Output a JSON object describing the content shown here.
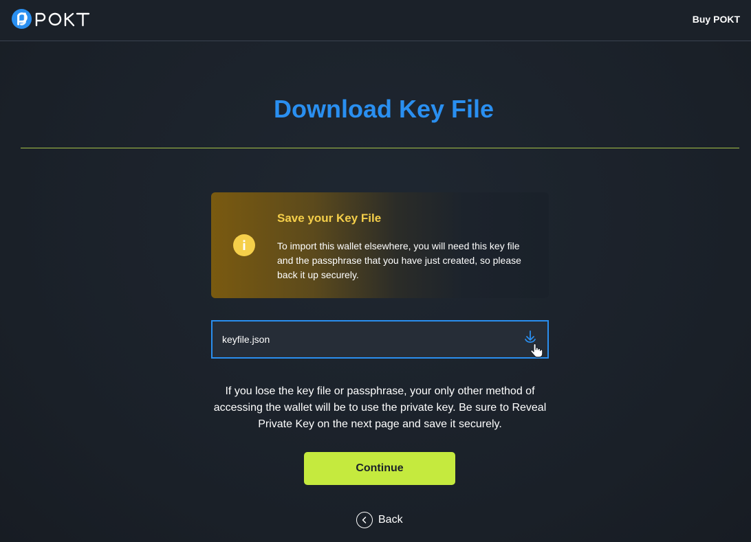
{
  "header": {
    "logo_text": "POKT",
    "buy_label": "Buy POKT"
  },
  "page": {
    "title": "Download Key File"
  },
  "info_card": {
    "icon": "info-icon",
    "title": "Save your Key File",
    "body": "To import this wallet elsewhere, you will need this key file and the passphrase that you have just created, so please back it up securely."
  },
  "file_field": {
    "filename": "keyfile.json",
    "icon": "download-icon"
  },
  "warning_text": "If you lose the key file or passphrase, your only other method of accessing the wallet will be to use the private key. Be sure to Reveal Private Key on the next page and save it securely.",
  "actions": {
    "continue_label": "Continue",
    "back_label": "Back"
  },
  "colors": {
    "accent_blue": "#2a8ff0",
    "accent_green": "#c5ea3e",
    "warning_yellow": "#f5cf4a",
    "background": "#1b2129"
  }
}
